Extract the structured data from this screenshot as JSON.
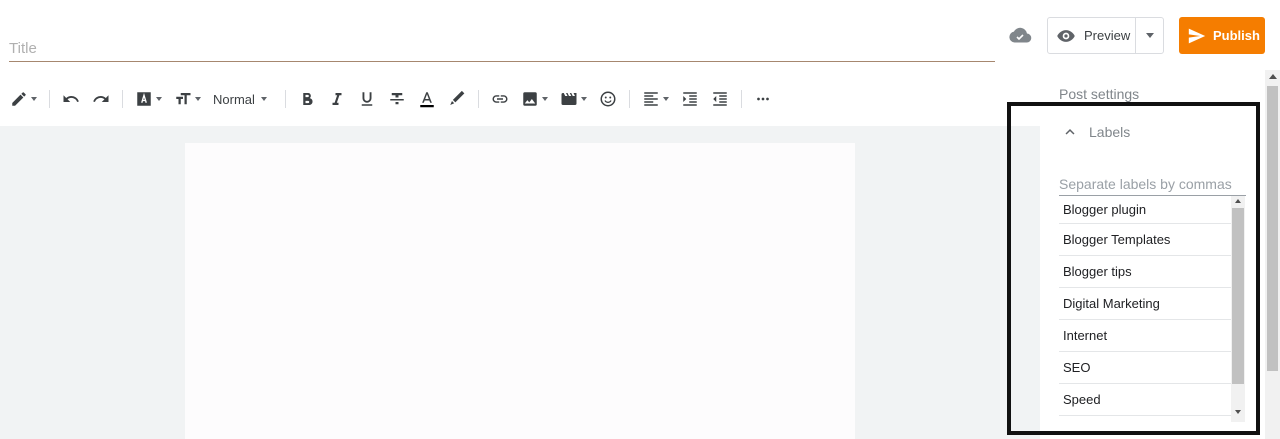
{
  "header": {
    "title_placeholder": "Title",
    "preview_label": "Preview",
    "publish_label": "Publish"
  },
  "toolbar": {
    "paragraph_style": "Normal"
  },
  "sidebar": {
    "heading": "Post settings",
    "labels_section": {
      "title": "Labels",
      "input_placeholder": "Separate labels by commas",
      "items": [
        {
          "label": "Blogger plugin"
        },
        {
          "label": "Blogger Templates"
        },
        {
          "label": "Blogger tips"
        },
        {
          "label": "Digital Marketing"
        },
        {
          "label": "Internet"
        },
        {
          "label": "SEO"
        },
        {
          "label": "Speed"
        }
      ]
    }
  },
  "colors": {
    "publish_accent": "#f57d00",
    "highlight_border": "#111111"
  }
}
